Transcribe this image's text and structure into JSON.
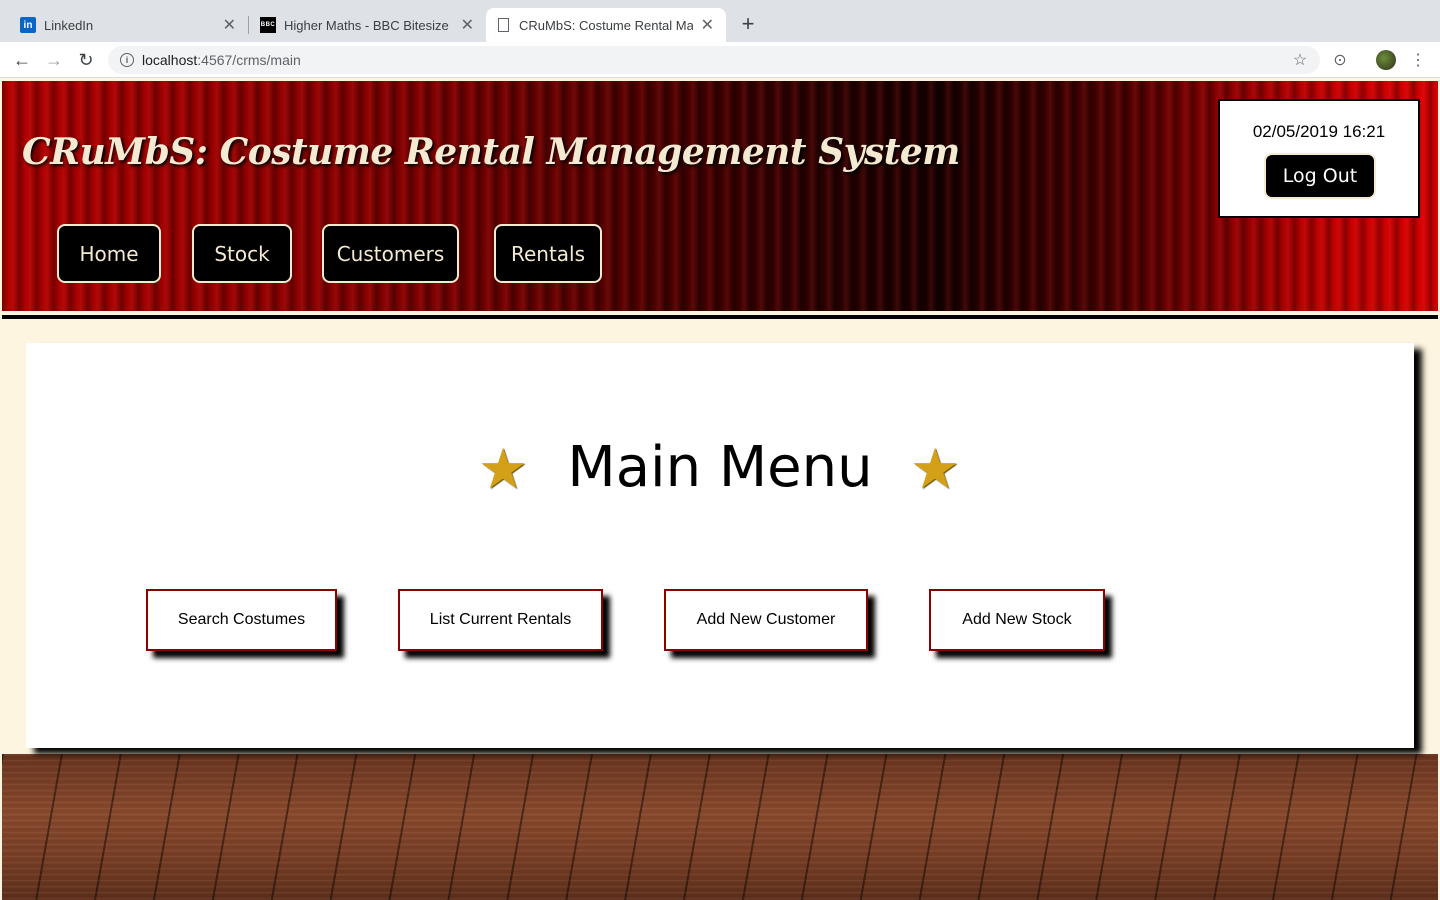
{
  "browser": {
    "tabs": [
      {
        "title": "LinkedIn",
        "icon": "linkedin-icon",
        "active": false
      },
      {
        "title": "Higher Maths - BBC Bitesize",
        "icon": "bbc-icon",
        "active": false
      },
      {
        "title": "CRuMbS: Costume Rental Man",
        "icon": "document-icon",
        "active": true
      }
    ],
    "url_host": "localhost",
    "url_path": ":4567/crms/main"
  },
  "header": {
    "title": "CRuMbS: Costume Rental Management System",
    "nav": [
      "Home",
      "Stock",
      "Customers",
      "Rentals"
    ],
    "datetime": "02/05/2019 16:21",
    "logout_label": "Log Out"
  },
  "main": {
    "title": "Main Menu",
    "star_glyph": "★",
    "actions": [
      "Search Costumes",
      "List Current Rentals",
      "Add New Customer",
      "Add New Stock"
    ]
  },
  "colors": {
    "accent": "#8b0000",
    "nav_bg": "#000000",
    "nav_text": "#f4ead2",
    "page_bg": "#fdf5e0",
    "star": "#d4a017"
  }
}
